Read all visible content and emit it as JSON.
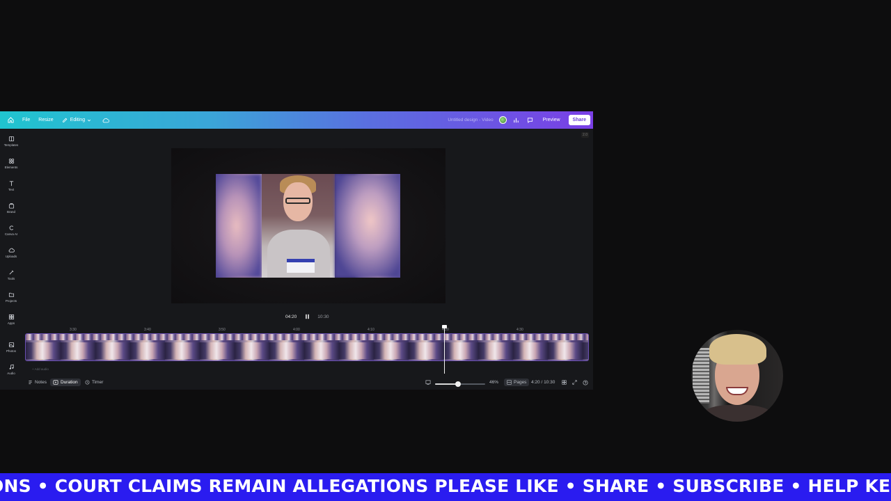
{
  "topbar": {
    "home_icon": "home-icon",
    "file_label": "File",
    "resize_label": "Resize",
    "editing_label": "Editing",
    "doc_title": "Untitled design - Video",
    "preview_label": "Preview",
    "share_label": "Share",
    "version_badge": "2.0"
  },
  "rail": {
    "items": [
      {
        "label": "Templates",
        "icon": "templates-icon"
      },
      {
        "label": "Elements",
        "icon": "elements-icon"
      },
      {
        "label": "Text",
        "icon": "text-icon"
      },
      {
        "label": "Brand",
        "icon": "brand-icon"
      },
      {
        "label": "Canva AI",
        "icon": "canva-ai-icon"
      },
      {
        "label": "Uploads",
        "icon": "uploads-icon"
      },
      {
        "label": "Tools",
        "icon": "tools-icon"
      },
      {
        "label": "Projects",
        "icon": "projects-icon"
      },
      {
        "label": "Apps",
        "icon": "apps-icon"
      },
      {
        "label": "Photos",
        "icon": "photos-icon"
      },
      {
        "label": "Audio",
        "icon": "audio-icon"
      }
    ]
  },
  "playback": {
    "current_time": "04:20",
    "total_time": "10:30"
  },
  "timeline": {
    "ticks": [
      "3:30",
      "3:40",
      "3:50",
      "4:00",
      "4:10",
      "4:20",
      "4:30"
    ],
    "add_audio": "+ Add audio"
  },
  "bottombar": {
    "notes_label": "Notes",
    "duration_label": "Duration",
    "timer_label": "Timer",
    "zoom_percent": "46%",
    "zoom_value": 0.46,
    "pages_label": "Pages",
    "time_readout": "4:20 / 10:30"
  },
  "ticker": {
    "text": "ONS • COURT CLAIMS REMAIN ALLEGATIONS PLEASE LIKE • SHARE • SUBSCRIBE • HELP KEEP SE"
  },
  "colors": {
    "ticker_bg": "#2a1cf0",
    "topbar_start": "#20c4cf",
    "topbar_end": "#7a3fe6",
    "share_text": "#6b3fd8"
  }
}
